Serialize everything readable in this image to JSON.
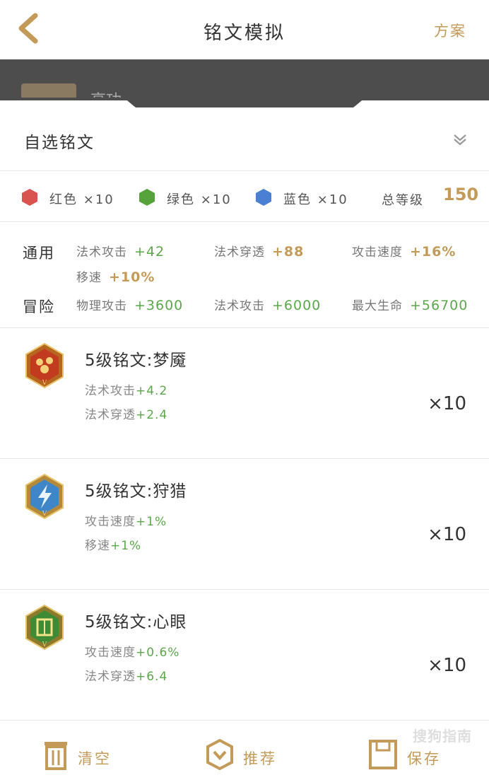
{
  "nav": {
    "title": "铭文模拟",
    "right_action": "方案"
  },
  "backdrop": {
    "hero_name": "高功"
  },
  "selector": {
    "label": "自选铭文"
  },
  "colors": [
    {
      "name": "红色",
      "count": "×10",
      "hex": "#d9534f"
    },
    {
      "name": "绿色",
      "count": "×10",
      "hex": "#56a23b"
    },
    {
      "name": "蓝色",
      "count": "×10",
      "hex": "#4a7fd4"
    }
  ],
  "total": {
    "label": "总等级",
    "value": "150"
  },
  "stats": {
    "general_label": "通用",
    "general": [
      {
        "name": "法术攻击",
        "value": "+42"
      },
      {
        "name": "法术穿透",
        "value": "+88"
      },
      {
        "name": "攻击速度",
        "value": "+16%"
      },
      {
        "name": "移速",
        "value": "+10%"
      }
    ],
    "adventure_label": "冒险",
    "adventure": [
      {
        "name": "物理攻击",
        "value": "+3600"
      },
      {
        "name": "法术攻击",
        "value": "+6000"
      },
      {
        "name": "最大生命",
        "value": "+56700"
      }
    ]
  },
  "runes": [
    {
      "name": "5级铭文:梦魇",
      "icon": "red-rune-icon",
      "attrs": [
        {
          "name": "法术攻击",
          "value": "+4.2"
        },
        {
          "name": "法术穿透",
          "value": "+2.4"
        }
      ],
      "count": "×10"
    },
    {
      "name": "5级铭文:狩猎",
      "icon": "blue-rune-icon",
      "attrs": [
        {
          "name": "攻击速度",
          "value": "+1%"
        },
        {
          "name": "移速",
          "value": "+1%"
        }
      ],
      "count": "×10"
    },
    {
      "name": "5级铭文:心眼",
      "icon": "green-rune-icon",
      "attrs": [
        {
          "name": "攻击速度",
          "value": "+0.6%"
        },
        {
          "name": "法术穿透",
          "value": "+6.4"
        }
      ],
      "count": "×10"
    }
  ],
  "bottom": {
    "clear": "清空",
    "recommend": "推荐",
    "save": "保存"
  },
  "watermark": "搜狗指南"
}
